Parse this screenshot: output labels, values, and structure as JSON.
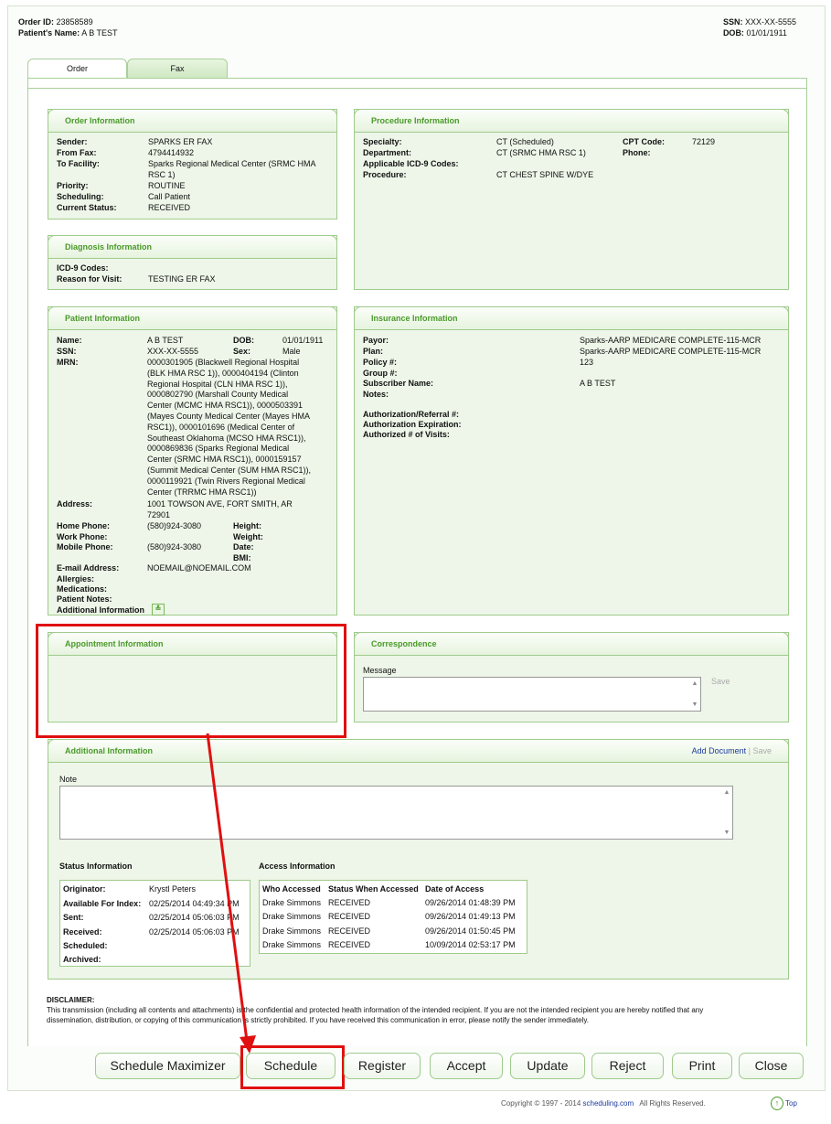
{
  "header": {
    "order_id_label": "Order ID:",
    "order_id": "23858589",
    "patient_name_label": "Patient's Name:",
    "patient_name": "A B TEST",
    "ssn_label": "SSN:",
    "ssn": "XXX-XX-5555",
    "dob_label": "DOB:",
    "dob": "01/01/1911"
  },
  "tabs": [
    {
      "label": "Order"
    },
    {
      "label": "Fax"
    }
  ],
  "order_info": {
    "title": "Order Information",
    "rows": [
      {
        "label": "Sender:",
        "value": "SPARKS ER FAX"
      },
      {
        "label": "From Fax:",
        "value": "4794414932"
      },
      {
        "label": "To Facility:",
        "value": "Sparks Regional Medical Center (SRMC HMA RSC 1)"
      },
      {
        "label": "Priority:",
        "value": "ROUTINE"
      },
      {
        "label": "Scheduling:",
        "value": "Call Patient"
      },
      {
        "label": "Current Status:",
        "value": "RECEIVED"
      }
    ]
  },
  "procedure_info": {
    "title": "Procedure Information",
    "specialty_label": "Specialty:",
    "specialty": "CT (Scheduled)",
    "department_label": "Department:",
    "department": "CT (SRMC HMA RSC 1)",
    "icd_label": "Applicable ICD-9 Codes:",
    "icd": "",
    "procedure_label": "Procedure:",
    "procedure": "CT CHEST SPINE W/DYE",
    "cpt_label": "CPT Code:",
    "cpt": "72129",
    "phone_label": "Phone:",
    "phone": ""
  },
  "diagnosis_info": {
    "title": "Diagnosis Information",
    "icd_label": "ICD-9 Codes:",
    "icd": "",
    "reason_label": "Reason for Visit:",
    "reason": "TESTING ER FAX"
  },
  "patient_info": {
    "title": "Patient Information",
    "name_label": "Name:",
    "name": "A B TEST",
    "dob_label": "DOB:",
    "dob": "01/01/1911",
    "ssn_label": "SSN:",
    "ssn": "XXX-XX-5555",
    "sex_label": "Sex:",
    "sex": "Male",
    "mrn_label": "MRN:",
    "mrn_lines": [
      "0000301905 (Blackwell Regional Hospital",
      "(BLK HMA RSC 1)), 0000404194 (Clinton",
      "Regional Hospital (CLN HMA RSC 1)),",
      "0000802790 (Marshall County Medical",
      "Center (MCMC HMA RSC1)), 0000503391",
      "(Mayes County Medical Center (Mayes HMA",
      "RSC1)), 0000101696 (Medical Center of",
      "Southeast Oklahoma (MCSO HMA RSC1)),",
      "0000869836 (Sparks Regional Medical",
      "Center (SRMC HMA RSC1)), 0000159157",
      "(Summit Medical Center (SUM HMA RSC1)),",
      "0000119921 (Twin Rivers Regional Medical",
      "Center (TRRMC HMA RSC1))"
    ],
    "address_label": "Address:",
    "address_lines": [
      "1001 TOWSON AVE, FORT SMITH, AR",
      "72901"
    ],
    "home_phone_label": "Home Phone:",
    "home_phone": "(580)924-3080",
    "work_phone_label": "Work Phone:",
    "work_phone": "",
    "mobile_phone_label": "Mobile Phone:",
    "mobile_phone": "(580)924-3080",
    "height_label": "Height:",
    "weight_label": "Weight:",
    "date_label": "Date:",
    "bmi_label": "BMI:",
    "email_label": "E-mail Address:",
    "email": "NOEMAIL@NOEMAIL.COM",
    "allergies_label": "Allergies:",
    "medications_label": "Medications:",
    "patient_notes_label": "Patient Notes:",
    "additional_label": "Additional Information"
  },
  "insurance_info": {
    "title": "Insurance Information",
    "payor_label": "Payor:",
    "payor": "Sparks-AARP MEDICARE COMPLETE-115-MCR",
    "plan_label": "Plan:",
    "plan": "Sparks-AARP MEDICARE COMPLETE-115-MCR",
    "policy_label": "Policy #:",
    "policy": "123",
    "group_label": "Group #:",
    "group": "",
    "subscriber_label": "Subscriber Name:",
    "subscriber": "A B TEST",
    "notes_label": "Notes:",
    "auth_ref_label": "Authorization/Referral #:",
    "auth_exp_label": "Authorization Expiration:",
    "auth_visits_label": "Authorized # of Visits:"
  },
  "appointment_info": {
    "title": "Appointment Information"
  },
  "correspondence": {
    "title": "Correspondence",
    "message_label": "Message",
    "save_label": "Save"
  },
  "additional_info": {
    "title": "Additional Information",
    "add_document": "Add Document",
    "separator": "|",
    "save_label": "Save",
    "note_label": "Note"
  },
  "status_info": {
    "title": "Status Information",
    "rows": [
      {
        "label": "Originator:",
        "value": "Krystl Peters"
      },
      {
        "label": "Available For Index:",
        "value": "02/25/2014 04:49:34 PM"
      },
      {
        "label": "Sent:",
        "value": "02/25/2014 05:06:03 PM"
      },
      {
        "label": "Received:",
        "value": "02/25/2014 05:06:03 PM"
      },
      {
        "label": "Scheduled:",
        "value": ""
      },
      {
        "label": "Archived:",
        "value": ""
      }
    ]
  },
  "access_info": {
    "title": "Access Information",
    "columns": [
      "Who Accessed",
      "Status When Accessed",
      "Date of Access"
    ],
    "rows": [
      [
        "Drake Simmons",
        "RECEIVED",
        "09/26/2014 01:48:39 PM"
      ],
      [
        "Drake Simmons",
        "RECEIVED",
        "09/26/2014 01:49:13 PM"
      ],
      [
        "Drake Simmons",
        "RECEIVED",
        "09/26/2014 01:50:45 PM"
      ],
      [
        "Drake Simmons",
        "RECEIVED",
        "10/09/2014 02:53:17 PM"
      ]
    ]
  },
  "disclaimer": {
    "title": "DISCLAIMER:",
    "line1": "This transmission (including all contents and attachments) is the confidential and protected health information of the intended recipient. If you are not the intended recipient you are hereby notified that any",
    "line2": "dissemination, distribution, or copying of this communication is strictly prohibited. If you have received this communication in error, please notify the sender immediately."
  },
  "buttons": [
    "Schedule Maximizer",
    "Schedule",
    "Register",
    "Accept",
    "Update",
    "Reject",
    "Print",
    "Close"
  ],
  "footer": {
    "copyright": "Copyright © 1997 - 2014",
    "site": "scheduling.com",
    "rights": "All Rights Reserved.",
    "top_label": "Top"
  },
  "colors": {
    "accent_green": "#4a9a2a",
    "highlight_red": "#e01010",
    "link_blue": "#1a3a9c"
  }
}
